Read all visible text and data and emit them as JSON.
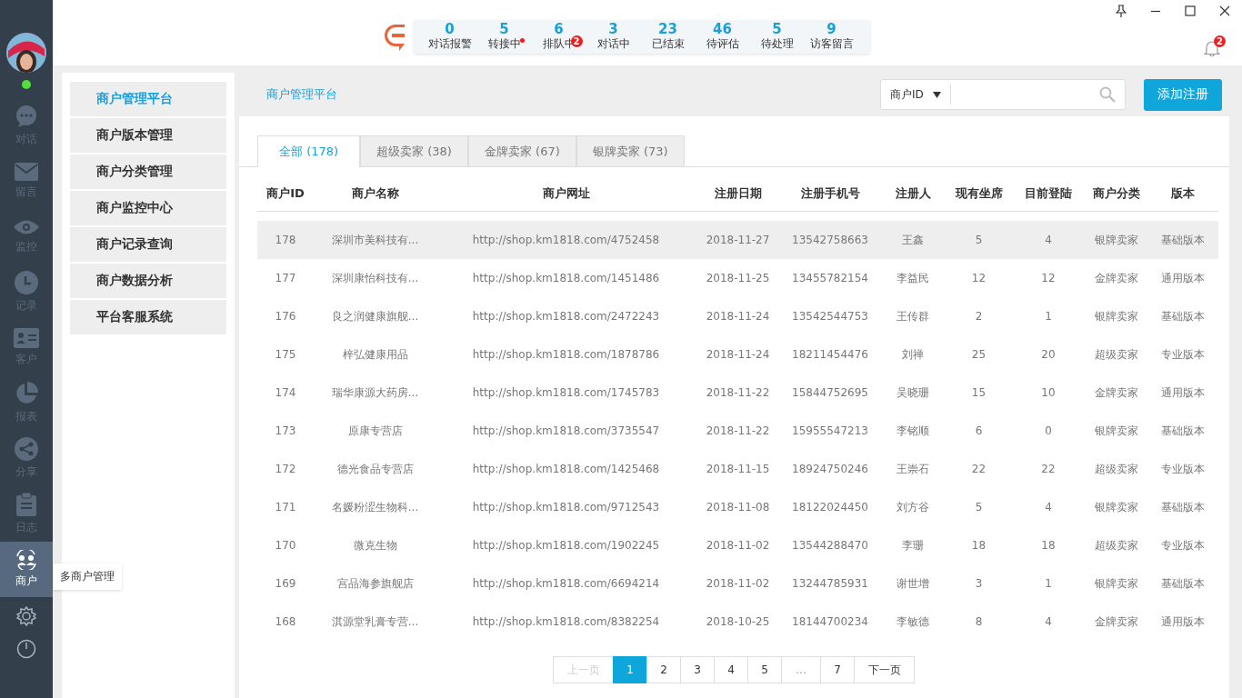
{
  "rail": {
    "status": {
      "color": "#52e03c"
    },
    "items": [
      {
        "kind": "chat",
        "label": "对话",
        "selected": false
      },
      {
        "kind": "mail",
        "label": "留言",
        "selected": false
      },
      {
        "kind": "eye",
        "label": "监控",
        "selected": false
      },
      {
        "kind": "clock",
        "label": "记录",
        "selected": false
      },
      {
        "kind": "card",
        "label": "客户",
        "selected": false
      },
      {
        "kind": "pie",
        "label": "报表",
        "selected": false
      },
      {
        "kind": "share",
        "label": "分享",
        "selected": false
      },
      {
        "kind": "clipboard",
        "label": "日志",
        "selected": false
      },
      {
        "kind": "users",
        "label": "商户",
        "selected": true
      }
    ],
    "tooltip": "多商户管理"
  },
  "stats": [
    {
      "value": "0",
      "label": "对话报警",
      "dot": false
    },
    {
      "value": "5",
      "label": "转接中",
      "dot": true
    },
    {
      "value": "6",
      "label": "排队中",
      "dot": false,
      "badge": "2"
    },
    {
      "value": "3",
      "label": "对话中",
      "dot": false
    },
    {
      "value": "23",
      "label": "已结束",
      "dot": false
    },
    {
      "value": "46",
      "label": "待评估",
      "dot": false
    },
    {
      "value": "5",
      "label": "待处理",
      "dot": false
    },
    {
      "value": "9",
      "label": "访客留言",
      "dot": false
    }
  ],
  "notifications": {
    "badge": "2"
  },
  "submenu": [
    {
      "label": "商户管理平台",
      "selected": true
    },
    {
      "label": "商户版本管理",
      "selected": false
    },
    {
      "label": "商户分类管理",
      "selected": false
    },
    {
      "label": "商户监控中心",
      "selected": false
    },
    {
      "label": "商户记录查询",
      "selected": false
    },
    {
      "label": "商户数据分析",
      "selected": false
    },
    {
      "label": "平台客服系统",
      "selected": false
    }
  ],
  "breadcrumb": "商户管理平台",
  "search": {
    "filter": "商户ID"
  },
  "add_button": "添加注册",
  "tabs": [
    {
      "label": "全部 (178)",
      "selected": true
    },
    {
      "label": "超级卖家 (38)",
      "selected": false
    },
    {
      "label": "金牌卖家 (67)",
      "selected": false
    },
    {
      "label": "银牌卖家 (73)",
      "selected": false
    }
  ],
  "table": {
    "columns": [
      "商户ID",
      "商户名称",
      "商户网址",
      "注册日期",
      "注册手机号",
      "注册人",
      "现有坐席",
      "目前登陆",
      "商户分类",
      "版本"
    ],
    "rows": [
      {
        "selected": true,
        "cells": [
          "178",
          "深圳市美科技有...",
          "http://shop.km1818.com/4752458",
          "2018-11-27",
          "13542758663",
          "王鑫",
          "5",
          "4",
          "银牌卖家",
          "基础版本"
        ]
      },
      {
        "selected": false,
        "cells": [
          "177",
          "深圳康怡科技有...",
          "http://shop.km1818.com/1451486",
          "2018-11-25",
          "13455782154",
          "李益民",
          "12",
          "12",
          "金牌卖家",
          "通用版本"
        ]
      },
      {
        "selected": false,
        "cells": [
          "176",
          "良之润健康旗舰...",
          "http://shop.km1818.com/2472243",
          "2018-11-24",
          "13542544753",
          "王传群",
          "2",
          "1",
          "银牌卖家",
          "基础版本"
        ]
      },
      {
        "selected": false,
        "cells": [
          "175",
          "梓弘健康用品",
          "http://shop.km1818.com/1878786",
          "2018-11-24",
          "18211454476",
          "刘禅",
          "25",
          "20",
          "超级卖家",
          "专业版本"
        ]
      },
      {
        "selected": false,
        "cells": [
          "174",
          "瑞华康源大药房...",
          "http://shop.km1818.com/1745783",
          "2018-11-22",
          "15844752695",
          "吴晓珊",
          "15",
          "10",
          "金牌卖家",
          "通用版本"
        ]
      },
      {
        "selected": false,
        "cells": [
          "173",
          "原康专营店",
          "http://shop.km1818.com/3735547",
          "2018-11-22",
          "15955547213",
          "李铭顺",
          "6",
          "0",
          "银牌卖家",
          "基础版本"
        ]
      },
      {
        "selected": false,
        "cells": [
          "172",
          "德光食品专营店",
          "http://shop.km1818.com/1425468",
          "2018-11-15",
          "18924750246",
          "王崇石",
          "22",
          "22",
          "超级卖家",
          "专业版本"
        ]
      },
      {
        "selected": false,
        "cells": [
          "171",
          "名媛粉涩生物科...",
          "http://shop.km1818.com/9712543",
          "2018-11-08",
          "18122024450",
          "刘方谷",
          "5",
          "4",
          "银牌卖家",
          "基础版本"
        ]
      },
      {
        "selected": false,
        "cells": [
          "170",
          "微克生物",
          "http://shop.km1818.com/1902245",
          "2018-11-02",
          "13544288470",
          "李珊",
          "18",
          "18",
          "超级卖家",
          "专业版本"
        ]
      },
      {
        "selected": false,
        "cells": [
          "169",
          "宫品海参旗舰店",
          "http://shop.km1818.com/6694214",
          "2018-11-02",
          "13244785931",
          "谢世增",
          "3",
          "1",
          "银牌卖家",
          "基础版本"
        ]
      },
      {
        "selected": false,
        "cells": [
          "168",
          "淇源堂乳膏专营...",
          "http://shop.km1818.com/8382254",
          "2018-10-25",
          "18144700234",
          "李敏德",
          "8",
          "4",
          "金牌卖家",
          "通用版本"
        ]
      }
    ]
  },
  "pagination": [
    {
      "label": "上一页",
      "kind": "prev",
      "disabled": true,
      "selected": false
    },
    {
      "label": "1",
      "kind": "page",
      "disabled": false,
      "selected": true
    },
    {
      "label": "2",
      "kind": "page",
      "disabled": false,
      "selected": false
    },
    {
      "label": "3",
      "kind": "page",
      "disabled": false,
      "selected": false
    },
    {
      "label": "4",
      "kind": "page",
      "disabled": false,
      "selected": false
    },
    {
      "label": "5",
      "kind": "page",
      "disabled": false,
      "selected": false
    },
    {
      "label": "...",
      "kind": "gap",
      "disabled": false,
      "selected": false
    },
    {
      "label": "7",
      "kind": "page",
      "disabled": false,
      "selected": false
    },
    {
      "label": "下一页",
      "kind": "next",
      "disabled": false,
      "selected": false
    }
  ]
}
